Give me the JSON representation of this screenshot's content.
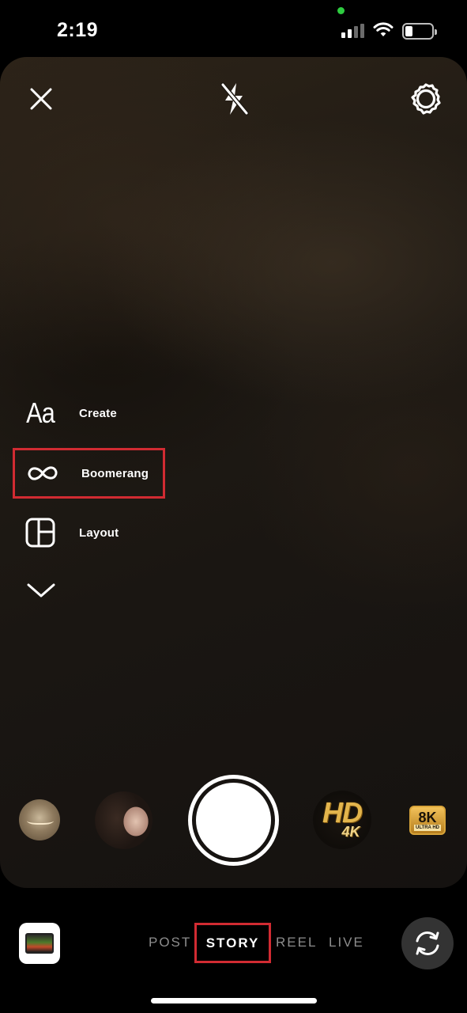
{
  "status_bar": {
    "time": "2:19"
  },
  "top_controls": {
    "close_icon": "close-icon",
    "flash_icon": "flash-off-icon",
    "settings_icon": "gear-icon"
  },
  "side_tools": {
    "create": {
      "icon_text": "Aa",
      "label": "Create"
    },
    "boomerang": {
      "icon": "infinity-icon",
      "label": "Boomerang"
    },
    "layout": {
      "icon": "layout-grid-icon",
      "label": "Layout"
    },
    "expand_icon": "chevron-down-icon"
  },
  "effects": {
    "hd": {
      "main": "HD",
      "sub": "4K"
    },
    "eight_k": {
      "main": "8K",
      "sub": "ULTRA HD"
    }
  },
  "modes": {
    "post": "POST",
    "story": "STORY",
    "reel": "REEL",
    "live": "LIVE",
    "selected": "STORY"
  },
  "colors": {
    "highlight": "#d12b32",
    "accent_gold": "#e3b54c"
  }
}
